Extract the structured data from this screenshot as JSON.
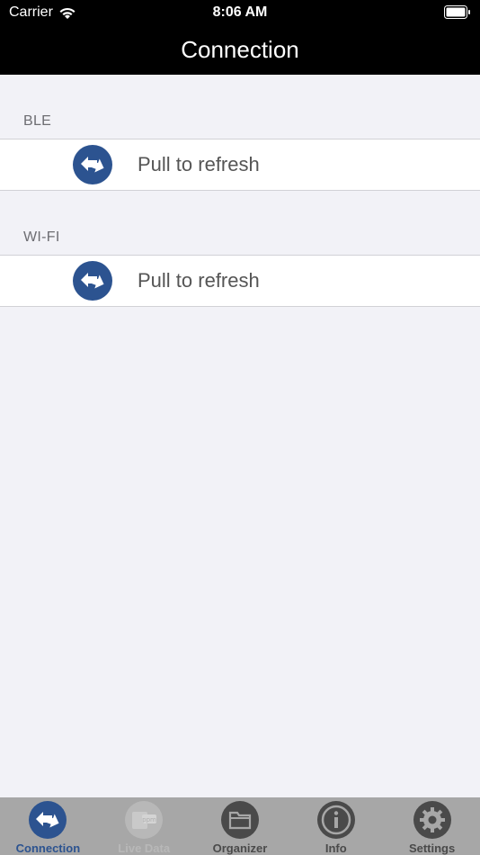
{
  "status": {
    "carrier": "Carrier",
    "time": "8:06 AM"
  },
  "nav": {
    "title": "Connection"
  },
  "sections": [
    {
      "header": "BLE",
      "cell_label": "Pull to refresh"
    },
    {
      "header": "WI-FI",
      "cell_label": "Pull to refresh"
    }
  ],
  "tabs": [
    {
      "label": "Connection",
      "icon": "connection-icon",
      "state": "active"
    },
    {
      "label": "Live Data",
      "icon": "ppm-icon",
      "state": "disabled"
    },
    {
      "label": "Organizer",
      "icon": "folder-icon",
      "state": "normal"
    },
    {
      "label": "Info",
      "icon": "info-icon",
      "state": "normal"
    },
    {
      "label": "Settings",
      "icon": "gear-icon",
      "state": "normal"
    }
  ],
  "colors": {
    "accent": "#2c5390",
    "navbar": "#000000",
    "background": "#f2f2f7",
    "tabbar": "#a7a7a7",
    "tab_icon": "#4a4a4a"
  }
}
